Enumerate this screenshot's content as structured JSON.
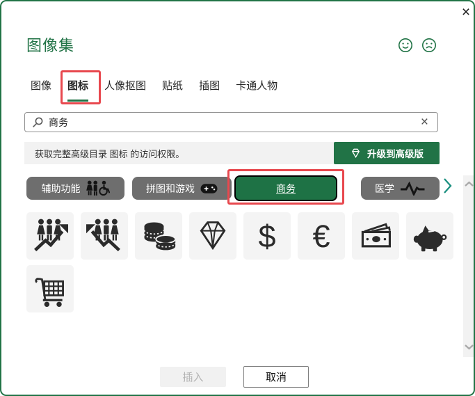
{
  "window": {
    "title": "图像集",
    "close_glyph": "×"
  },
  "tabs": [
    {
      "label": "图像"
    },
    {
      "label": "图标"
    },
    {
      "label": "人像抠图"
    },
    {
      "label": "贴纸"
    },
    {
      "label": "插图"
    },
    {
      "label": "卡通人物"
    }
  ],
  "active_tab": "图标",
  "search": {
    "value": "商务",
    "clear_glyph": "×"
  },
  "promo": {
    "message": "获取完整高级目录 图标 的访问权限。",
    "upgrade_label": "升级到高级版"
  },
  "categories": {
    "items": [
      {
        "label": "辅助功能",
        "icon": "accessibility-icon",
        "selected": false
      },
      {
        "label": "拼图和游戏",
        "icon": "game-controller-icon",
        "selected": false
      },
      {
        "label": "商务",
        "icon": "",
        "selected": true
      },
      {
        "label": "医学",
        "icon": "pulse-icon",
        "selected": false
      }
    ]
  },
  "grid": {
    "tiles": [
      {
        "name": "team-growth-icon"
      },
      {
        "name": "team-trend-up-icon"
      },
      {
        "name": "coins-icon"
      },
      {
        "name": "diamond-icon"
      },
      {
        "name": "dollar-icon",
        "glyph": "$"
      },
      {
        "name": "euro-icon",
        "glyph": "€"
      },
      {
        "name": "banknotes-icon"
      },
      {
        "name": "piggy-bank-icon"
      },
      {
        "name": "shopping-cart-icon"
      }
    ]
  },
  "footer": {
    "insert_label": "插入",
    "cancel_label": "取消"
  },
  "colors": {
    "accent_green": "#217346",
    "annotation_red": "#e8484e",
    "pill_gray": "#6e6e6e",
    "tile_gray": "#f4f4f4",
    "icon_ink": "#2b2b2b"
  }
}
